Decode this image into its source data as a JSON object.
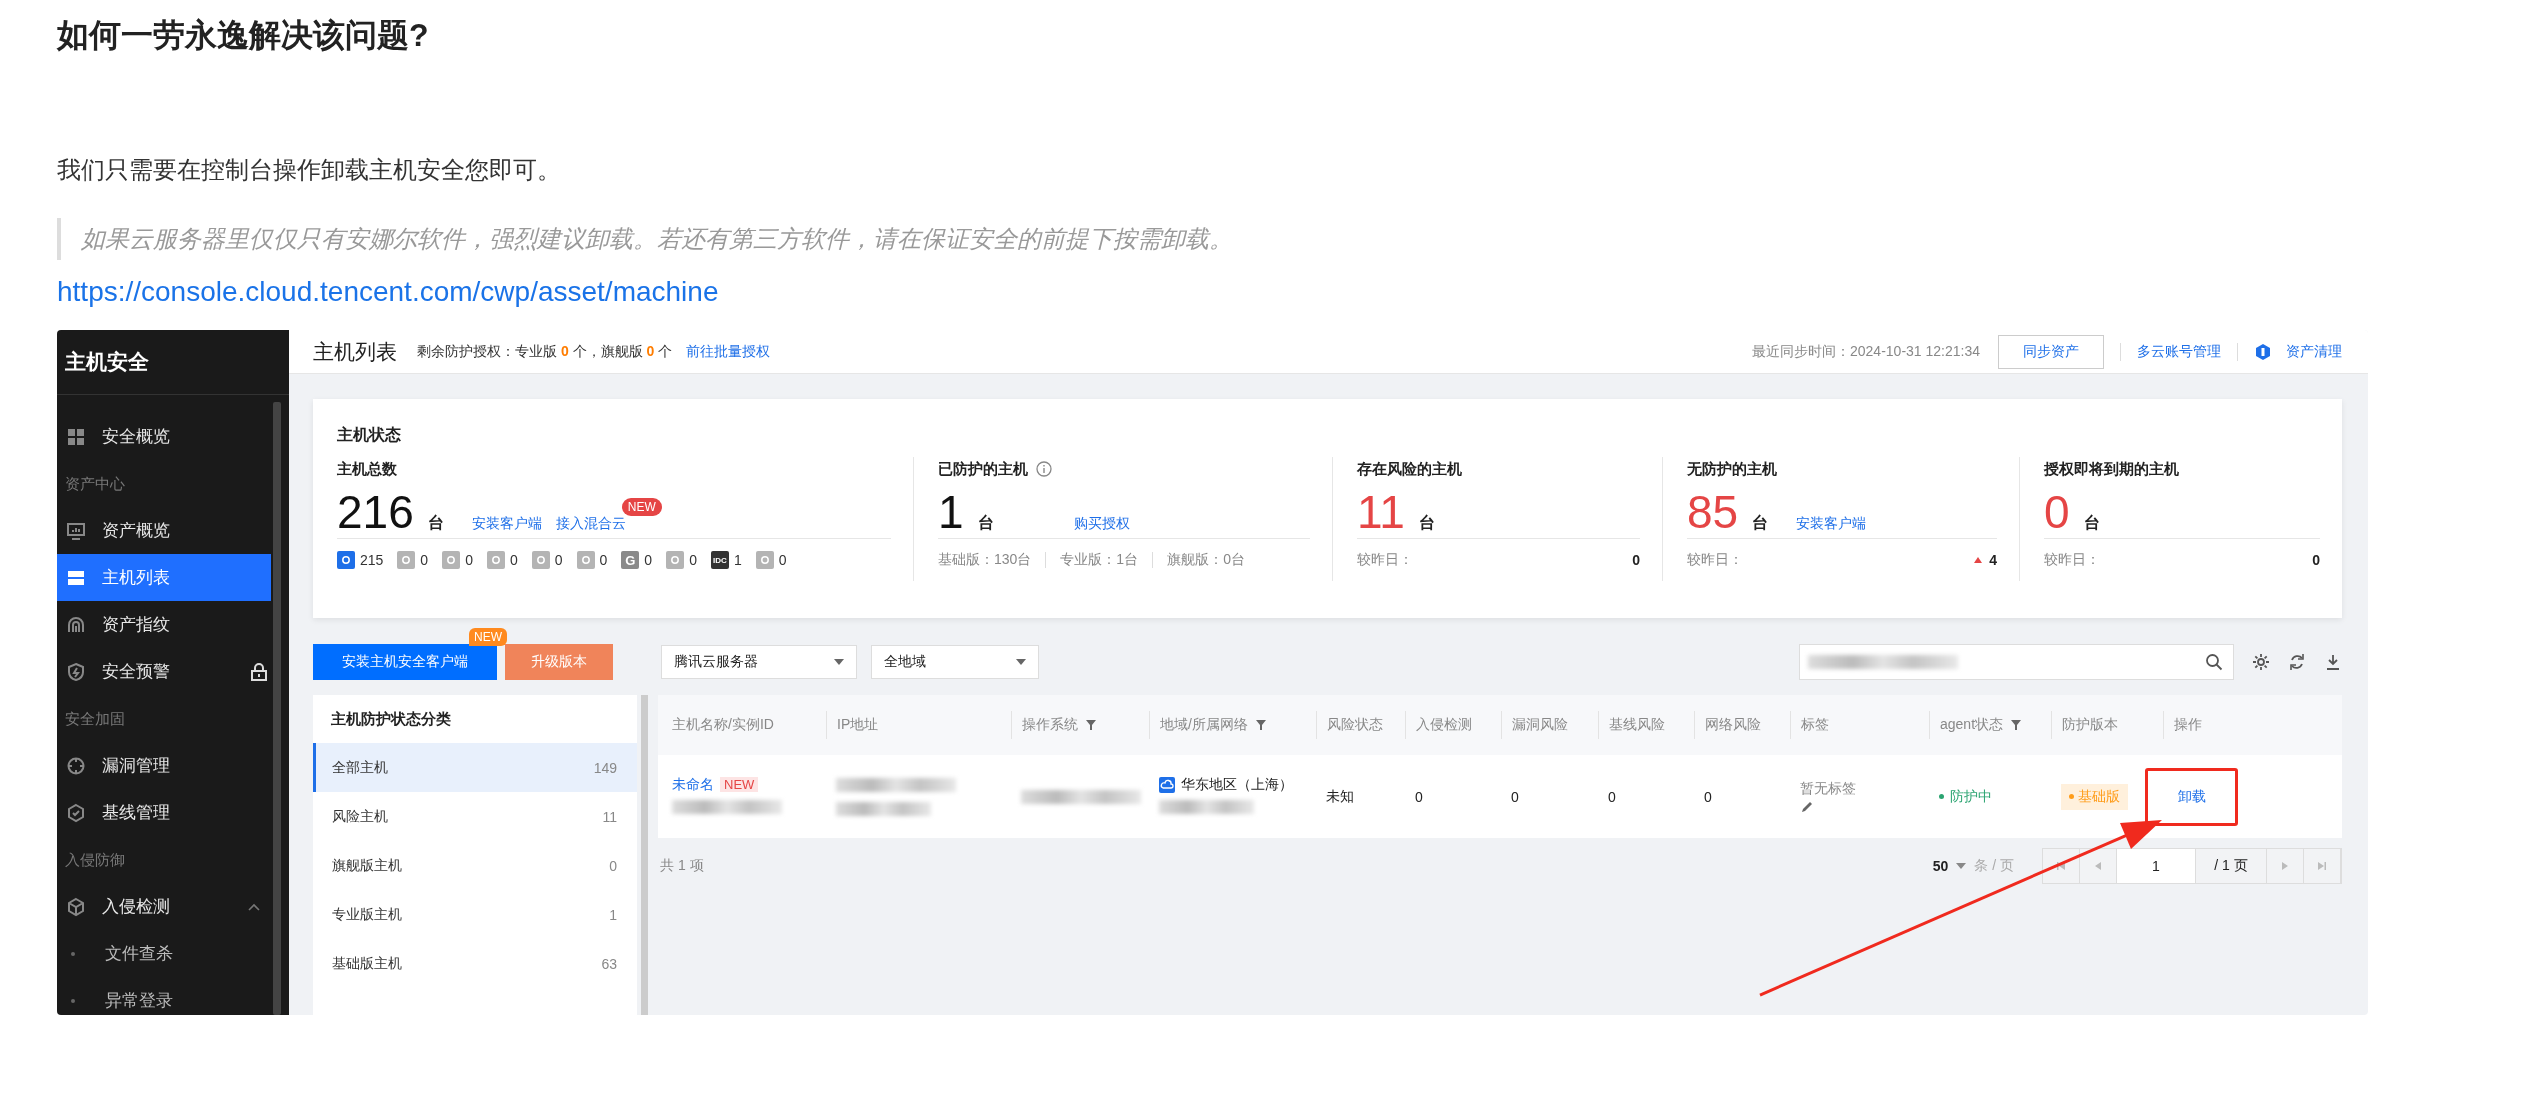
{
  "article": {
    "heading": "如何一劳永逸解决该问题?",
    "paragraph": "我们只需要在控制台操作卸载主机安全您即可。",
    "quote": "如果云服务器里仅仅只有安娜尔软件，强烈建议卸载。若还有第三方软件，请在保证安全的前提下按需卸载。",
    "link": "https://console.cloud.tencent.com/cwp/asset/machine"
  },
  "console": {
    "sidebar": {
      "title": "主机安全",
      "items": [
        {
          "kind": "item",
          "label": "安全概览",
          "selected": false
        },
        {
          "kind": "group",
          "label": "资产中心"
        },
        {
          "kind": "item",
          "label": "资产概览",
          "selected": false
        },
        {
          "kind": "item",
          "label": "主机列表",
          "selected": true
        },
        {
          "kind": "item",
          "label": "资产指纹",
          "selected": false
        },
        {
          "kind": "item",
          "label": "安全预警",
          "selected": false,
          "locked": true
        },
        {
          "kind": "group",
          "label": "安全加固"
        },
        {
          "kind": "item",
          "label": "漏洞管理",
          "selected": false
        },
        {
          "kind": "item",
          "label": "基线管理",
          "selected": false
        },
        {
          "kind": "group",
          "label": "入侵防御"
        },
        {
          "kind": "item",
          "label": "入侵检测",
          "selected": false,
          "expanded": true
        },
        {
          "kind": "subitem",
          "label": "文件查杀"
        },
        {
          "kind": "subitem",
          "label": "异常登录"
        }
      ]
    },
    "header": {
      "title": "主机列表",
      "quota": "剩余防护授权：专业版 **0** 个，旗舰版 **0** 个",
      "batch_link": "前往批量授权",
      "sync_time": "最近同步时间：2024-10-31 12:21:34",
      "sync_button": "同步资产",
      "links": [
        "多云账号管理",
        "资产清理"
      ]
    },
    "stats": {
      "title": "主机状态",
      "columns": [
        {
          "label": "主机总数",
          "value": "216",
          "unit": "台",
          "alert": false,
          "links": [
            {
              "text": "安装客户端"
            },
            {
              "text": "接入混合云",
              "badge": "NEW"
            }
          ],
          "providers": [
            {
              "color": "#1e6fe8",
              "count": "215"
            },
            {
              "color": "#b4b4b4",
              "count": "0"
            },
            {
              "color": "#b4b4b4",
              "count": "0"
            },
            {
              "color": "#b4b4b4",
              "count": "0"
            },
            {
              "color": "#b4b4b4",
              "count": "0"
            },
            {
              "color": "#b4b4b4",
              "count": "0"
            },
            {
              "color": "#8a8a8a",
              "count": "0",
              "label": "G"
            },
            {
              "color": "#b4b4b4",
              "count": "0"
            },
            {
              "color": "#333333",
              "count": "1",
              "label": "IDC"
            },
            {
              "color": "#b4b4b4",
              "count": "0"
            }
          ]
        },
        {
          "label": "已防护的主机",
          "info": true,
          "value": "1",
          "unit": "台",
          "alert": false,
          "links": [
            {
              "text": "购买授权"
            }
          ],
          "breakdown": [
            "基础版：130台",
            "专业版：1台",
            "旗舰版：0台"
          ]
        },
        {
          "label": "存在风险的主机",
          "value": "11",
          "unit": "台",
          "alert": true,
          "compare_label": "较昨日：",
          "compare_value": "0"
        },
        {
          "label": "无防护的主机",
          "value": "85",
          "unit": "台",
          "alert": true,
          "links": [
            {
              "text": "安装客户端"
            }
          ],
          "compare_label": "较昨日：",
          "compare_value": "4",
          "rising": true
        },
        {
          "label": "授权即将到期的主机",
          "value": "0",
          "unit": "台",
          "alert": true,
          "compare_label": "较昨日：",
          "compare_value": "0"
        }
      ]
    },
    "toolbar": {
      "buttons": [
        {
          "label": "安装主机安全客户端",
          "kind": "primary",
          "badge": "NEW"
        },
        {
          "label": "升级版本",
          "kind": "upgrade"
        }
      ],
      "selects": [
        {
          "value": "腾讯云服务器"
        },
        {
          "value": "全地域"
        }
      ],
      "search_redacted": true
    },
    "categories": {
      "title": "主机防护状态分类",
      "items": [
        {
          "label": "全部主机",
          "count": "149",
          "selected": true
        },
        {
          "label": "风险主机",
          "count": "11",
          "selected": false
        },
        {
          "label": "旗舰版主机",
          "count": "0",
          "selected": false
        },
        {
          "label": "专业版主机",
          "count": "1",
          "selected": false
        },
        {
          "label": "基础版主机",
          "count": "63",
          "selected": false
        }
      ]
    },
    "table": {
      "columns": [
        {
          "label": "主机名称/实例ID",
          "filter": false
        },
        {
          "label": "IP地址",
          "filter": false
        },
        {
          "label": "操作系统",
          "filter": true
        },
        {
          "label": "地域/所属网络",
          "filter": true
        },
        {
          "label": "风险状态",
          "filter": false
        },
        {
          "label": "入侵检测",
          "filter": false
        },
        {
          "label": "漏洞风险",
          "filter": false
        },
        {
          "label": "基线风险",
          "filter": false
        },
        {
          "label": "网络风险",
          "filter": false
        },
        {
          "label": "标签",
          "filter": false
        },
        {
          "label": "agent状态",
          "filter": true
        },
        {
          "label": "防护版本",
          "filter": false
        },
        {
          "label": "操作",
          "filter": false
        }
      ],
      "rows": [
        {
          "cells": [
            {
              "kind": "name",
              "text": "未命名",
              "badge": "NEW",
              "redacted_id": true
            },
            {
              "kind": "redacted"
            },
            {
              "kind": "redacted"
            },
            {
              "kind": "region",
              "text": "华东地区（上海）",
              "redacted_network": true
            },
            {
              "kind": "text",
              "text": "未知"
            },
            {
              "kind": "text",
              "text": "0"
            },
            {
              "kind": "text",
              "text": "0"
            },
            {
              "kind": "text",
              "text": "0"
            },
            {
              "kind": "text",
              "text": "0"
            },
            {
              "kind": "tag",
              "text": "暂无标签"
            },
            {
              "kind": "status",
              "text": "防护中"
            },
            {
              "kind": "badge",
              "text": "基础版"
            },
            {
              "kind": "action",
              "text": "卸载",
              "highlighted": true
            }
          ]
        }
      ],
      "total": "共 1 项",
      "page_size": "50",
      "per_page": "条 / 页",
      "page": "1",
      "pages": "/ 1 页"
    },
    "annotation": {
      "arrow": true
    }
  }
}
